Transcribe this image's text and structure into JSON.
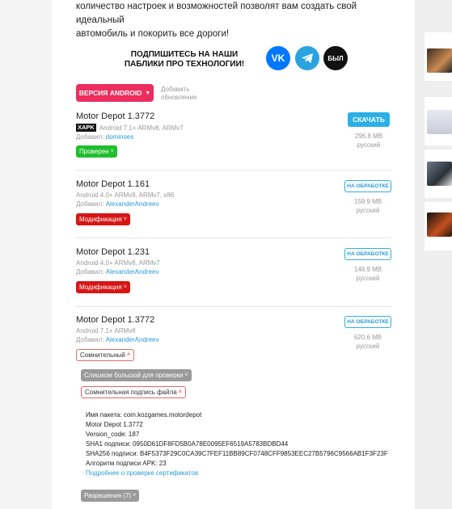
{
  "intro": {
    "line1": "количество настроек и возможностей позволят вам создать свой идеальный",
    "line2": "автомобиль и покорить все дороги!"
  },
  "promo": {
    "title": "ПОДПИШИТЕСЬ НА НАШИ ПАБЛИКИ ПРО ТЕХНОЛОГИИ!",
    "socials": [
      {
        "label": "VK",
        "icon": "vk-icon"
      },
      {
        "label": "",
        "icon": "telegram-icon"
      },
      {
        "label": "БЫЛ",
        "icon": "bbl-icon"
      }
    ]
  },
  "version_button": {
    "label": "ВЕРСИЯ ANDROID"
  },
  "add_update": {
    "label": "Добавить обновление"
  },
  "items": [
    {
      "name": "Motor Depot 1.3772",
      "badge": "XAPK",
      "meta": "Android 7.1+ ARMv8, ARMv7",
      "added_by_label": "Добавил:",
      "user": "dominoes",
      "tag": "Проверен",
      "action": "СКАЧАТЬ",
      "size": "296.8 MB",
      "lang": "русский"
    },
    {
      "name": "Motor Depot 1.161",
      "meta": "Android 4.0+ ARMv8, ARMv7, x86",
      "added_by_label": "Добавил:",
      "user": "AlexanderAndreev",
      "tag": "Модификация",
      "action": "НА ОБРАБОТКЕ",
      "size": "159.9 MB",
      "lang": "русский"
    },
    {
      "name": "Motor Depot 1.231",
      "meta": "Android 4.0+ ARMv8, ARMv7",
      "added_by_label": "Добавил:",
      "user": "AlexanderAndreev",
      "tag": "Модификация",
      "action": "НА ОБРАБОТКЕ",
      "size": "148.9 MB",
      "lang": "русский"
    },
    {
      "name": "Motor Depot 1.3772",
      "meta": "Android 7.1+ ARMv8",
      "added_by_label": "Добавил:",
      "user": "AlexanderAndreev",
      "tag": "Сомнительный",
      "action": "НА ОБРАБОТКЕ",
      "size": "620.6 MB",
      "lang": "русский"
    }
  ],
  "checks": {
    "too_big": "Слишком большой для проверки",
    "suspicious_sig": "Сомнительная подпись файла"
  },
  "details": {
    "package": "Имя пакета: com.kozgames.motordepot",
    "app_name": "Motor Depot 1.3772",
    "version_code": "Version_code: 187",
    "sha1": "SHA1 подписи: 0950D61DF8FD5B0A78E0095EF6519A5783BDBD44",
    "sha256": "SHA256 подписи: B4F5373F29C0CA39C7FEF11BB89CF0748CFF9853EEC27B5796C9566AB1F3F23F",
    "algo": "Алгоритм подписи APK: 23",
    "more_link": "Подробнее о проверке сертификатов"
  },
  "permissions": {
    "label": "Разрешения (7)"
  },
  "colors": {
    "accent_red": "#ec2d5d",
    "download_blue": "#2bb0e6",
    "verified_green": "#1fbf2c",
    "mod_red": "#d71616"
  }
}
